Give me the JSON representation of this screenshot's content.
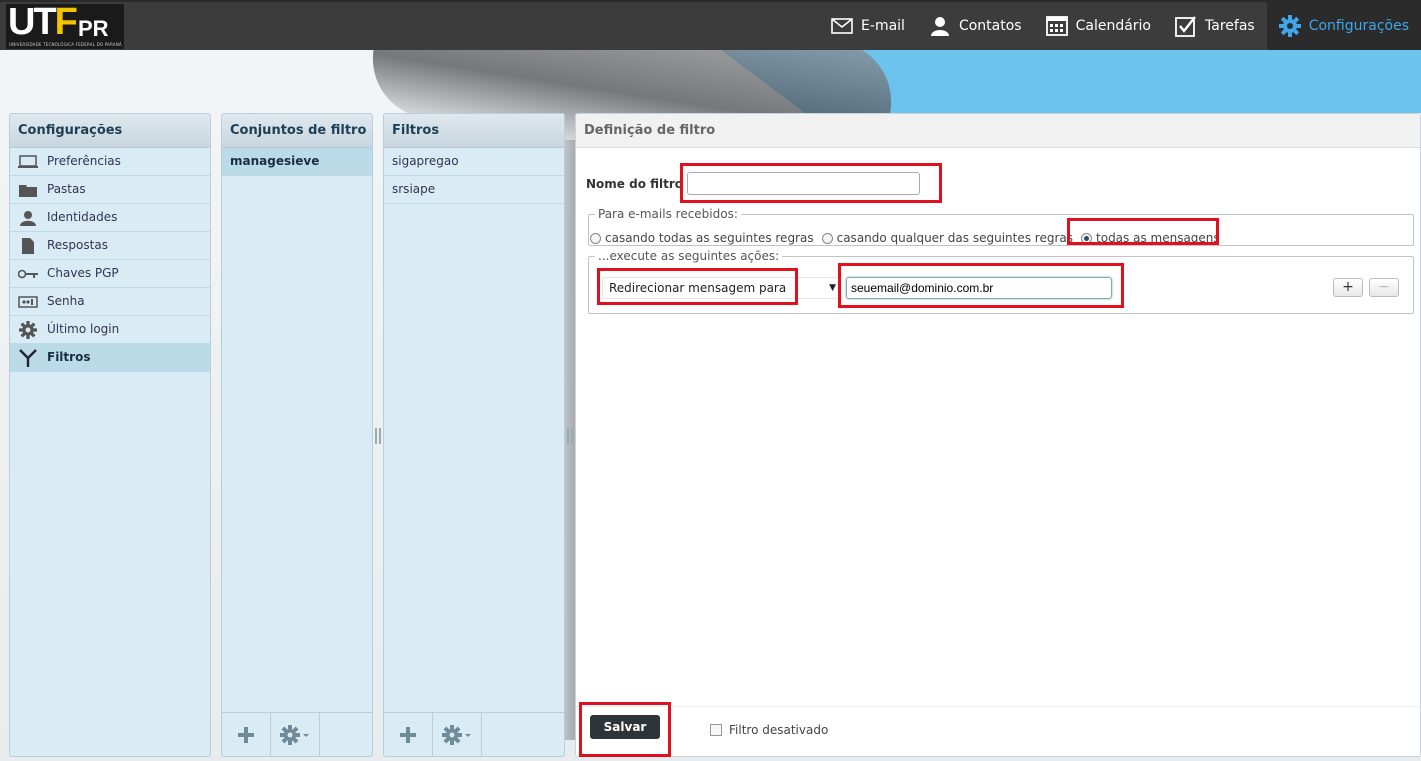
{
  "app": {
    "logo_text": "UTFPR",
    "logo_subtitle": "UNIVERSIDADE TECNOLÓGICA FEDERAL DO PARANÁ"
  },
  "nav": [
    {
      "label": "E-mail",
      "icon": "envelope-icon"
    },
    {
      "label": "Contatos",
      "icon": "person-icon"
    },
    {
      "label": "Calendário",
      "icon": "calendar-icon"
    },
    {
      "label": "Tarefas",
      "icon": "checkbox-icon"
    },
    {
      "label": "Configurações",
      "icon": "gear-icon",
      "active": true
    }
  ],
  "settings_panel": {
    "title": "Configurações",
    "items": [
      {
        "label": "Preferências",
        "icon": "monitor-icon"
      },
      {
        "label": "Pastas",
        "icon": "folder-icon"
      },
      {
        "label": "Identidades",
        "icon": "person-icon"
      },
      {
        "label": "Respostas",
        "icon": "document-icon"
      },
      {
        "label": "Chaves PGP",
        "icon": "key-icon"
      },
      {
        "label": "Senha",
        "icon": "password-icon"
      },
      {
        "label": "Último login",
        "icon": "gear-icon"
      },
      {
        "label": "Filtros",
        "icon": "filter-icon",
        "selected": true
      }
    ]
  },
  "filter_sets_panel": {
    "title": "Conjuntos de filtro",
    "items": [
      {
        "label": "managesieve",
        "selected": true
      }
    ]
  },
  "filters_panel": {
    "title": "Filtros",
    "items": [
      {
        "label": "sigapregao"
      },
      {
        "label": "srsiape"
      }
    ]
  },
  "filter_definition": {
    "title": "Definição de filtro",
    "name_label": "Nome do filtro",
    "name_value": "",
    "incoming_legend": "Para e-mails recebidos:",
    "match_options": [
      {
        "label": "casando todas as seguintes regras",
        "checked": false
      },
      {
        "label": "casando qualquer das seguintes regras",
        "checked": false
      },
      {
        "label": "todas as mensagens",
        "checked": true
      }
    ],
    "actions_legend": "...execute as seguintes ações:",
    "action_selected": "Redirecionar mensagem para",
    "action_target_value": "seuemail@dominio.com.br",
    "add_label": "+",
    "remove_label": "−",
    "save_label": "Salvar",
    "disabled_label": "Filtro desativado",
    "disabled_checked": false
  },
  "colors": {
    "accent": "#3ea6e9",
    "highlight": "#e0101f",
    "topbar": "#3c3c3c"
  }
}
